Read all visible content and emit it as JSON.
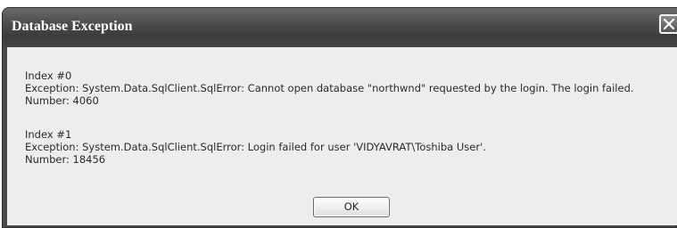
{
  "window": {
    "title": "Database Exception",
    "close_icon": "close-x-icon"
  },
  "errors": [
    {
      "index": "Index #0",
      "exception": "Exception: System.Data.SqlClient.SqlError: Cannot open database \"northwnd\" requested by the login. The login failed.",
      "number": "Number: 4060"
    },
    {
      "index": "Index #1",
      "exception": "Exception: System.Data.SqlClient.SqlError: Login failed for user 'VIDYAVRAT\\Toshiba User'.",
      "number": "Number: 18456"
    }
  ],
  "buttons": {
    "ok_label": "OK"
  }
}
